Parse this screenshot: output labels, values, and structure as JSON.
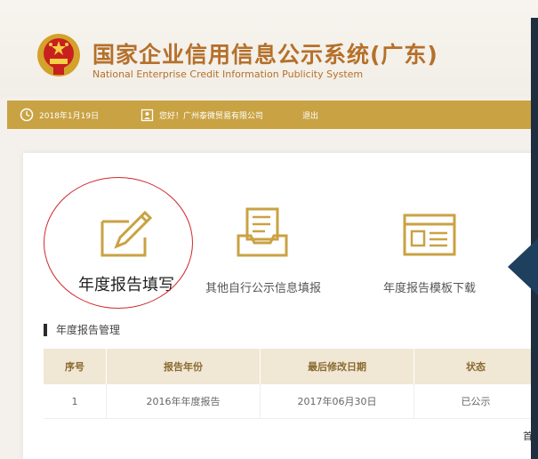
{
  "header": {
    "title_cn": "国家企业信用信息公示系统(广东)",
    "title_en": "National Enterprise Credit Information Publicity System",
    "emblem_icon": "national-emblem-icon"
  },
  "infobar": {
    "date": "2018年1月19日",
    "greeting": "您好！广州泰微贸易有限公司",
    "logout": "退出",
    "color": "#c9a243"
  },
  "tiles": [
    {
      "label": "年度报告填写",
      "icon": "edit-form-icon"
    },
    {
      "label": "其他自行公示信息填报",
      "icon": "inbox-tray-icon"
    },
    {
      "label": "年度报告模板下载",
      "icon": "template-doc-icon"
    }
  ],
  "section": {
    "title": "年度报告管理"
  },
  "table": {
    "headers": [
      "序号",
      "报告年份",
      "最后修改日期",
      "状态"
    ],
    "rows": [
      [
        "1",
        "2016年年度报告",
        "2017年06月30日",
        "已公示"
      ]
    ]
  },
  "corner_text": "首",
  "colors": {
    "accent": "#c9a243",
    "title": "#b5702a",
    "highlight": "#d0282a"
  }
}
